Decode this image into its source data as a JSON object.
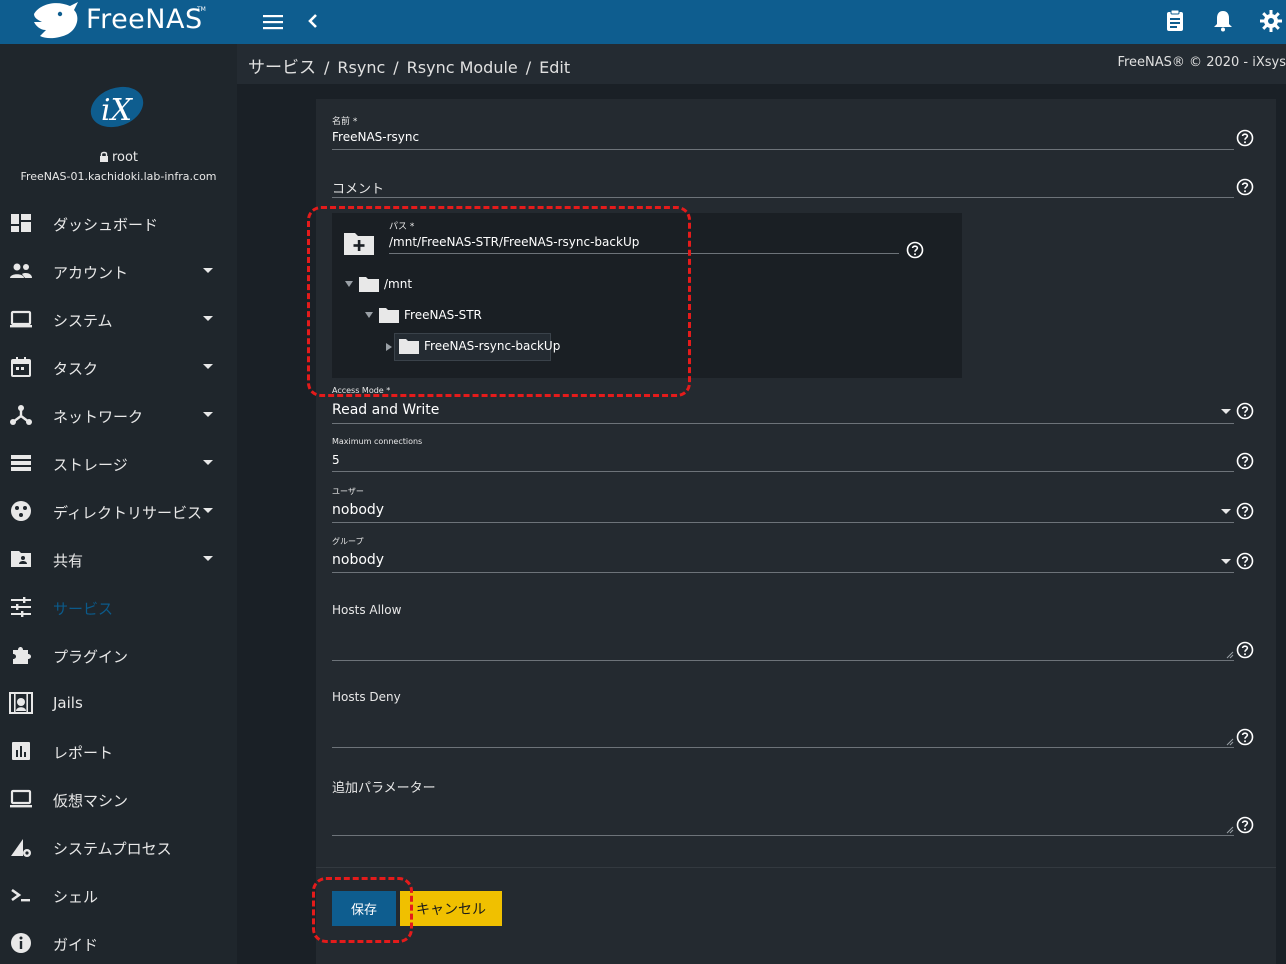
{
  "app": {
    "logo_text": "FreeNAS",
    "logo_tm": "TM"
  },
  "sidebar": {
    "user": "root",
    "hostname": "FreeNAS-01.kachidoki.lab-infra.com",
    "items": [
      {
        "label": "ダッシュボード",
        "icon": "dashboard-icon",
        "caret": false
      },
      {
        "label": "アカウント",
        "icon": "people-icon",
        "caret": true
      },
      {
        "label": "システム",
        "icon": "laptop-icon",
        "caret": true
      },
      {
        "label": "タスク",
        "icon": "calendar-icon",
        "caret": true
      },
      {
        "label": "ネットワーク",
        "icon": "network-icon",
        "caret": true
      },
      {
        "label": "ストレージ",
        "icon": "storage-icon",
        "caret": true
      },
      {
        "label": "ディレクトリサービス",
        "icon": "directory-icon",
        "caret": true
      },
      {
        "label": "共有",
        "icon": "shared-folder-icon",
        "caret": true
      },
      {
        "label": "サービス",
        "icon": "tune-icon",
        "caret": false,
        "active": true
      },
      {
        "label": "プラグイン",
        "icon": "puzzle-icon",
        "caret": false
      },
      {
        "label": "Jails",
        "icon": "jail-icon",
        "caret": false
      },
      {
        "label": "レポート",
        "icon": "chart-icon",
        "caret": false
      },
      {
        "label": "仮想マシン",
        "icon": "computer-icon",
        "caret": false
      },
      {
        "label": "システムプロセス",
        "icon": "process-icon",
        "caret": false
      },
      {
        "label": "シェル",
        "icon": "shell-icon",
        "caret": false
      },
      {
        "label": "ガイド",
        "icon": "info-icon",
        "caret": false
      }
    ]
  },
  "breadcrumb": {
    "items": [
      "サービス",
      "Rsync",
      "Rsync Module",
      "Edit"
    ],
    "copyright": "FreeNAS® © 2020 - iXsys"
  },
  "form": {
    "name": {
      "label": "名前 *",
      "value": "FreeNAS-rsync"
    },
    "comment": {
      "label": "コメント",
      "value": ""
    },
    "path": {
      "label": "パス *",
      "value": "/mnt/FreeNAS-STR/FreeNAS-rsync-backUp"
    },
    "tree": [
      {
        "label": "/mnt",
        "expanded": true
      },
      {
        "label": "FreeNAS-STR",
        "expanded": true
      },
      {
        "label": "FreeNAS-rsync-backUp",
        "expanded": false,
        "selected": true
      }
    ],
    "access_mode": {
      "label": "Access Mode *",
      "value": "Read and Write"
    },
    "max_connections": {
      "label": "Maximum connections",
      "value": "5"
    },
    "user": {
      "label": "ユーザー",
      "value": "nobody"
    },
    "group": {
      "label": "グループ",
      "value": "nobody"
    },
    "hosts_allow": {
      "label": "Hosts Allow",
      "value": ""
    },
    "hosts_deny": {
      "label": "Hosts Deny",
      "value": ""
    },
    "aux_params": {
      "label": "追加パラメーター",
      "value": ""
    }
  },
  "buttons": {
    "save": "保存",
    "cancel": "キャンセル"
  },
  "colors": {
    "topbar": "#0e5d8f",
    "sidebar": "#1f262c",
    "card": "#242a30",
    "accent": "#0e5d8f",
    "cancel": "#f0c000",
    "annotation": "#e41b1b"
  }
}
